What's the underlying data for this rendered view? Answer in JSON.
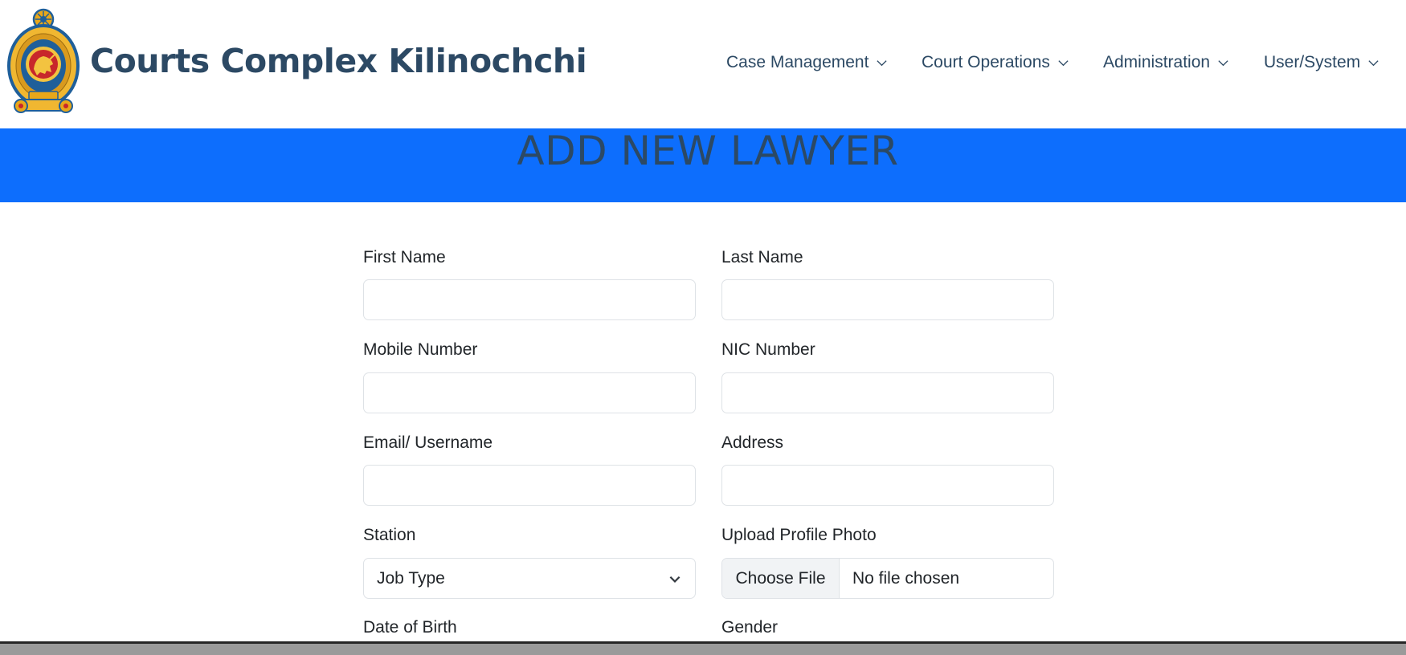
{
  "header": {
    "site_title": "Courts Complex Kilinochchi",
    "nav": [
      {
        "label": "Case Management",
        "icon": "chevron-down-icon"
      },
      {
        "label": "Court Operations",
        "icon": "chevron-down-icon"
      },
      {
        "label": "Administration",
        "icon": "chevron-down-icon"
      },
      {
        "label": "User/System",
        "icon": "chevron-down-icon"
      }
    ]
  },
  "banner": {
    "title": "ADD NEW LAWYER",
    "background_color": "#0d6efd"
  },
  "form": {
    "first_name": {
      "label": "First Name",
      "value": ""
    },
    "last_name": {
      "label": "Last Name",
      "value": ""
    },
    "mobile_number": {
      "label": "Mobile Number",
      "value": ""
    },
    "nic_number": {
      "label": "NIC Number",
      "value": ""
    },
    "email": {
      "label": "Email/ Username",
      "value": ""
    },
    "address": {
      "label": "Address",
      "value": ""
    },
    "station": {
      "label": "Station",
      "selected": "Job Type"
    },
    "profile_photo": {
      "label": "Upload Profile Photo",
      "button_label": "Choose File",
      "status": "No file chosen"
    },
    "date_of_birth": {
      "label": "Date of Birth"
    },
    "gender": {
      "label": "Gender"
    }
  },
  "colors": {
    "title_text": "#2c4964",
    "accent": "#0d6efd"
  }
}
